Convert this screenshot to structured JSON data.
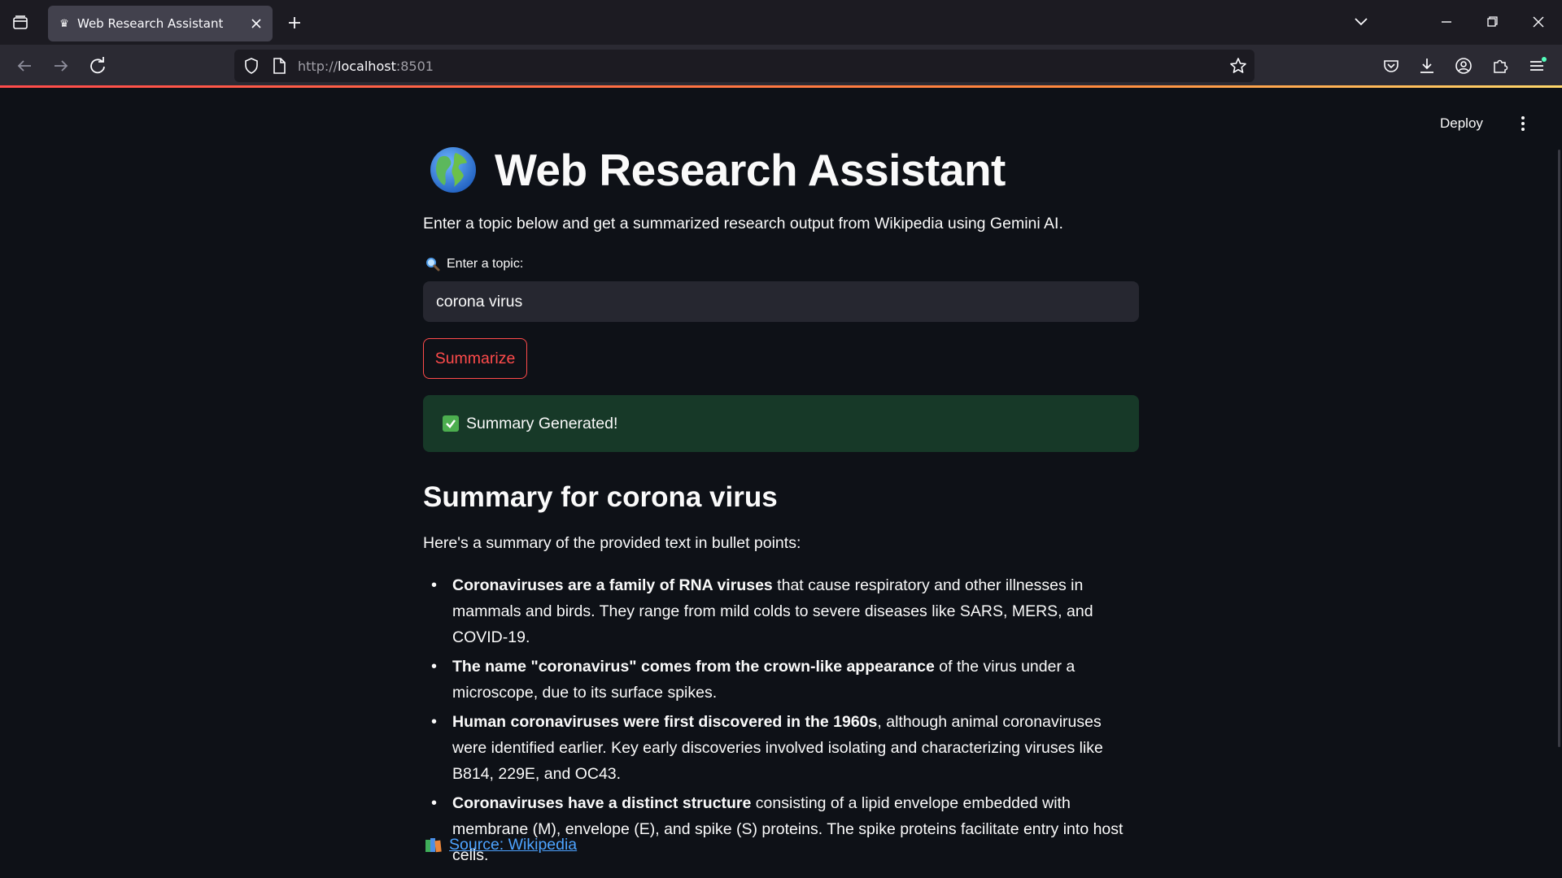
{
  "browser": {
    "tab_title": "Web Research Assistant",
    "url_scheme": "http://",
    "url_host": "localhost",
    "url_port": ":8501"
  },
  "toolbar": {
    "deploy_label": "Deploy"
  },
  "page": {
    "title": "Web Research Assistant",
    "intro": "Enter a topic below and get a summarized research output from Wikipedia using Gemini AI.",
    "input_label": "Enter a topic:",
    "input_value": "corona virus",
    "button_label": "Summarize",
    "success_message": "Summary Generated!",
    "summary_title": "Summary for corona virus",
    "summary_intro": "Here's a summary of the provided text in bullet points:",
    "bullets": [
      {
        "bold": "Coronaviruses are a family of RNA viruses",
        "rest": " that cause respiratory and other illnesses in mammals and birds. They range from mild colds to severe diseases like SARS, MERS, and COVID-19."
      },
      {
        "bold": "The name \"coronavirus\" comes from the crown-like appearance",
        "rest": " of the virus under a microscope, due to its surface spikes."
      },
      {
        "bold": "Human coronaviruses were first discovered in the 1960s",
        "rest": ", although animal coronaviruses were identified earlier. Key early discoveries involved isolating and characterizing viruses like B814, 229E, and OC43."
      },
      {
        "bold": "Coronaviruses have a distinct structure",
        "rest": " consisting of a lipid envelope embedded with membrane (M), envelope (E), and spike (S) proteins. The spike proteins facilitate entry into host cells."
      }
    ],
    "source_link": "Source: Wikipedia"
  },
  "colors": {
    "background": "#0e1117",
    "accent": "#ff4b4b",
    "success_bg": "#173928",
    "link": "#4da3ff"
  }
}
